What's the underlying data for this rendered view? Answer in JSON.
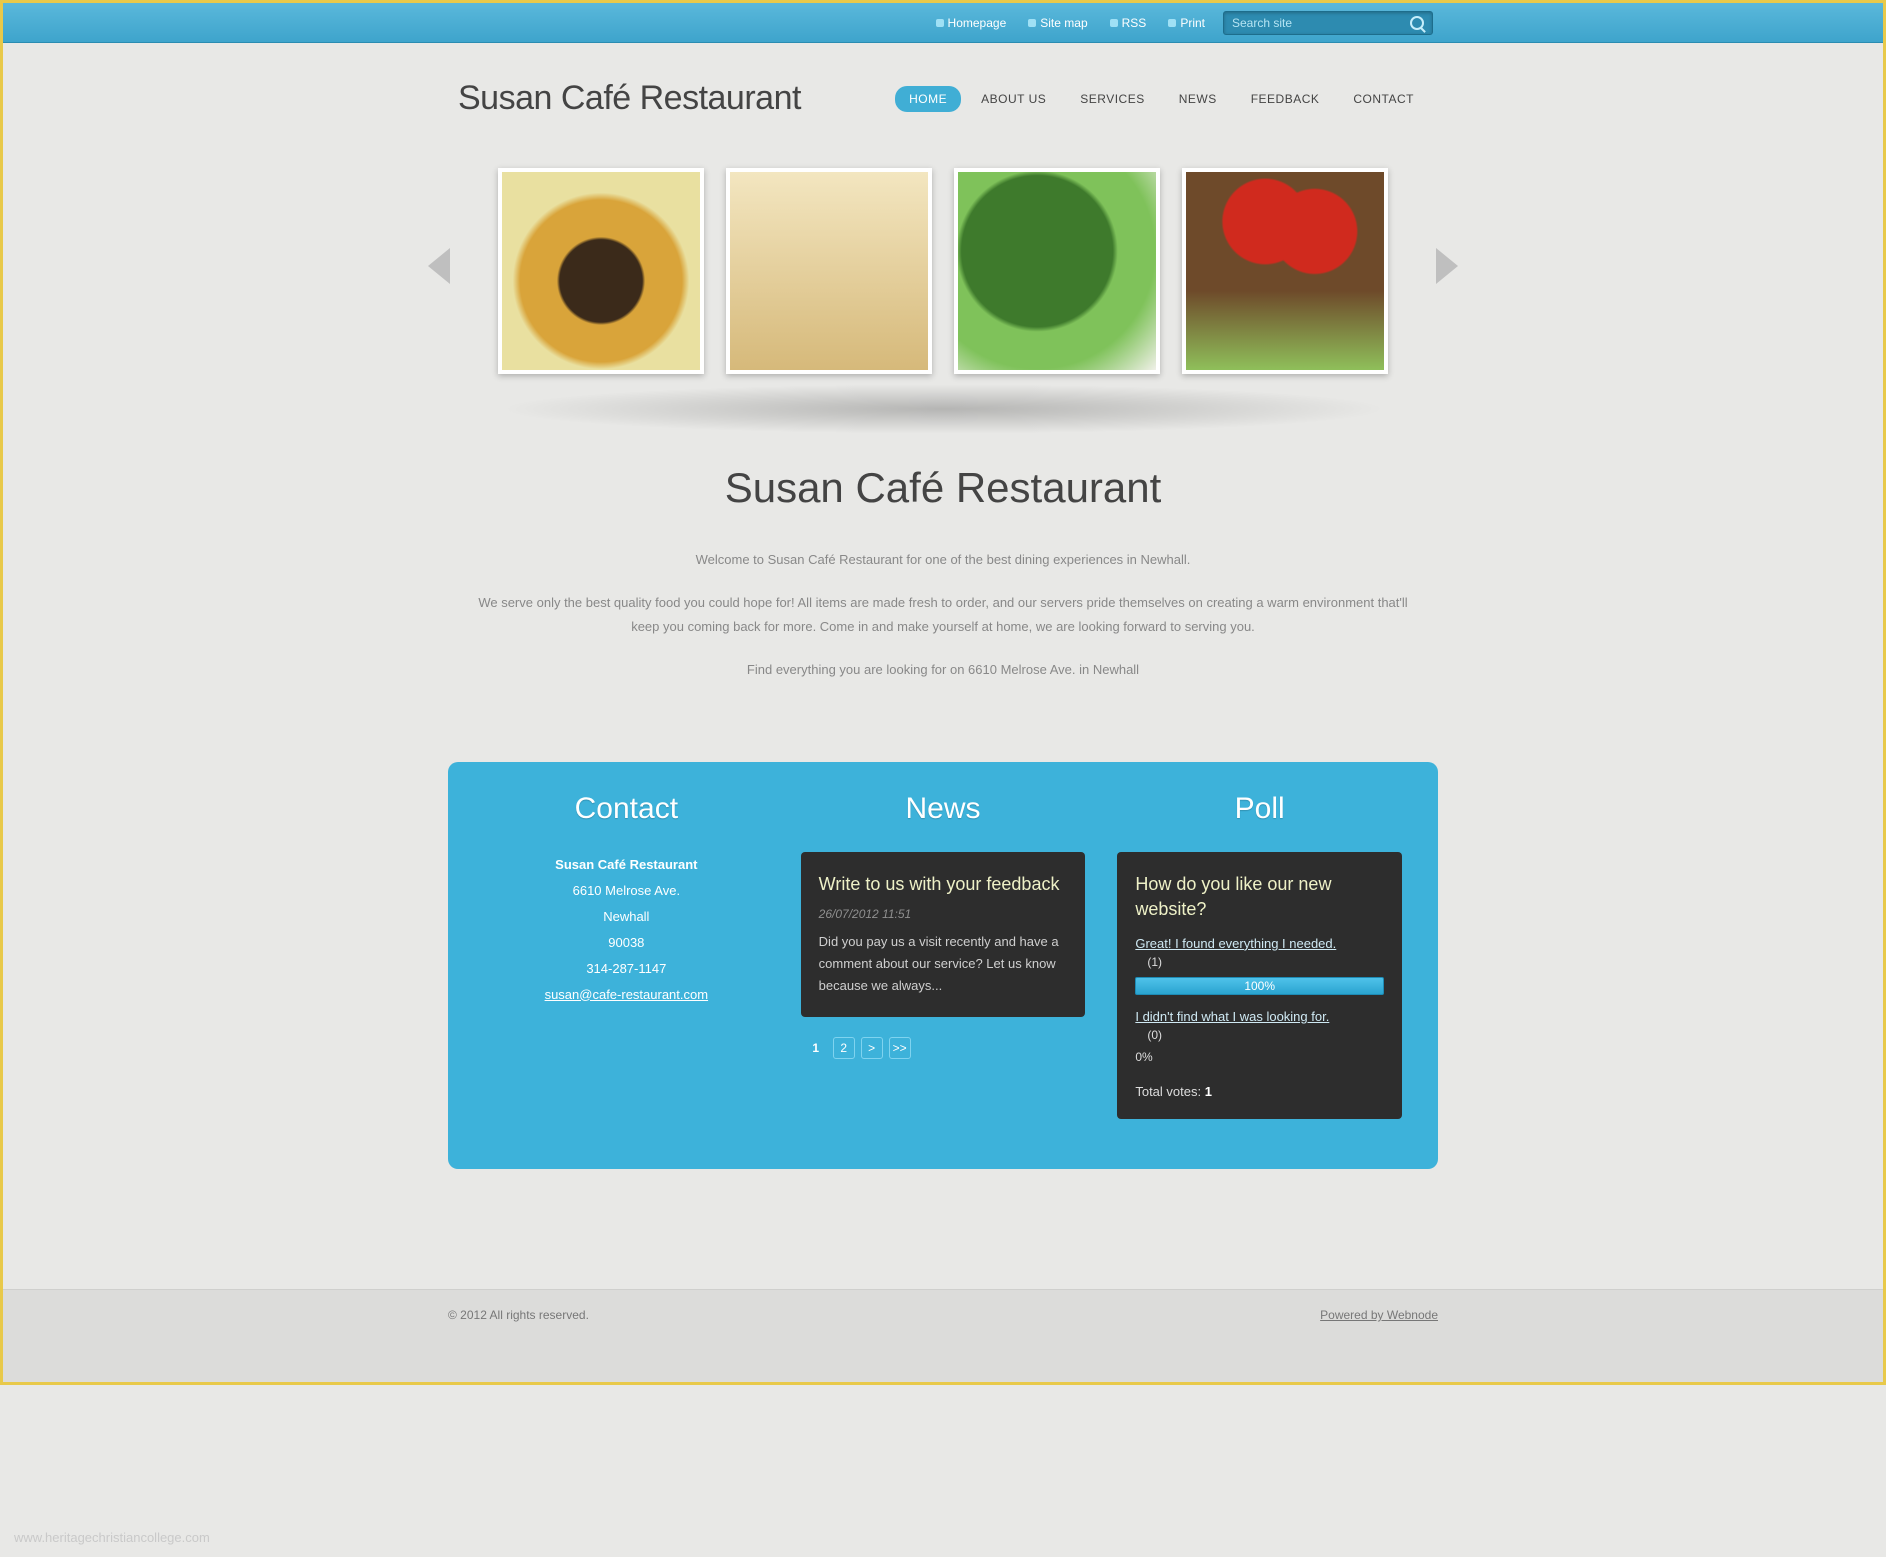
{
  "topbar": {
    "links": [
      "Homepage",
      "Site map",
      "RSS",
      "Print"
    ],
    "search_placeholder": "Search site"
  },
  "site_title": "Susan Café Restaurant",
  "nav": [
    {
      "label": "HOME",
      "active": true
    },
    {
      "label": "ABOUT US",
      "active": false
    },
    {
      "label": "SERVICES",
      "active": false
    },
    {
      "label": "NEWS",
      "active": false
    },
    {
      "label": "FEEDBACK",
      "active": false
    },
    {
      "label": "CONTACT",
      "active": false
    }
  ],
  "intro": {
    "heading": "Susan Café Restaurant",
    "p1": "Welcome to Susan Café Restaurant for one of the best dining experiences in Newhall.",
    "p2": "We serve only the best quality food you could hope for! All items are made fresh to order, and our servers pride themselves on creating a warm environment that'll keep you coming back for more. Come in and make yourself at home, we are looking forward to serving you.",
    "p3": "Find everything you are looking for on 6610 Melrose Ave. in Newhall"
  },
  "contact": {
    "heading": "Contact",
    "name": "Susan Café Restaurant",
    "addr1": "6610 Melrose Ave.",
    "city": "Newhall",
    "zip": "90038",
    "phone": "314-287-1147",
    "email": "susan@cafe-restaurant.com"
  },
  "news": {
    "heading": "News",
    "title": "Write to us with your feedback",
    "date": "26/07/2012 11:51",
    "body": "Did you pay us a visit recently and have a comment about our service? Let us know because we always...",
    "pager": [
      "1",
      "2",
      ">",
      ">>"
    ]
  },
  "poll": {
    "heading": "Poll",
    "question": "How do you like our new website?",
    "opt1": "Great! I found everything I needed.",
    "count1": "(1)",
    "pct1": "100%",
    "opt2": "I didn't find what I was looking for.",
    "count2": "(0)",
    "pct2": "0%",
    "total_label": "Total votes: ",
    "total_value": "1"
  },
  "footer": {
    "copyright": "© 2012 All rights reserved.",
    "powered": "Powered by Webnode"
  },
  "watermark": "www.heritagechristiancollege.com"
}
